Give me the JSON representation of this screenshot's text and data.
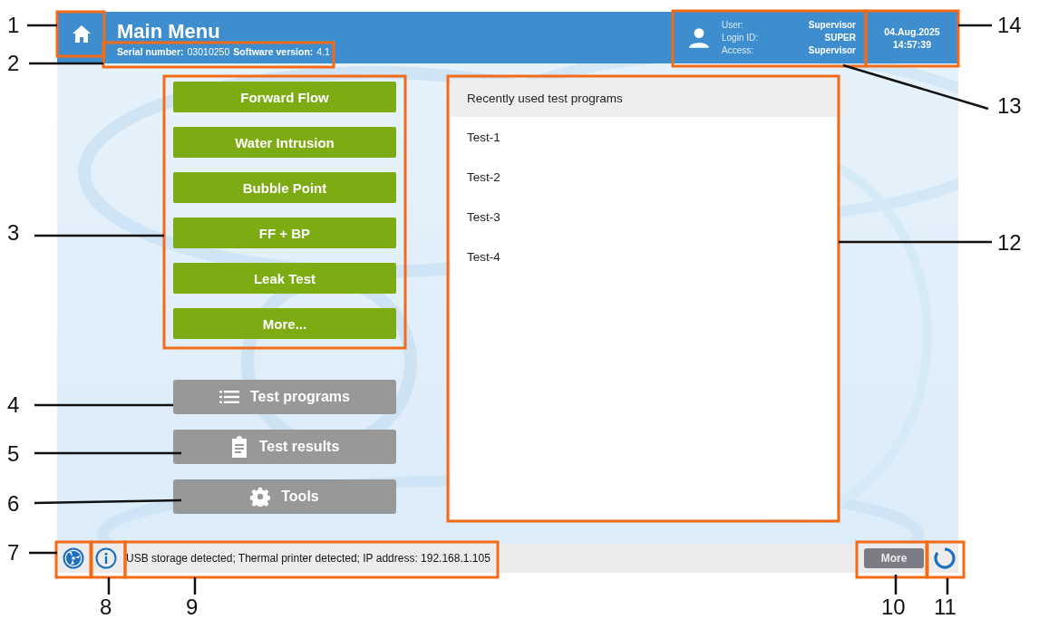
{
  "header": {
    "title": "Main Menu",
    "serial_label": "Serial number:",
    "serial": "03010250",
    "version_label": "Software version:",
    "version": "4.1"
  },
  "user": {
    "rows": [
      {
        "label": "User:",
        "value": "Supervisor"
      },
      {
        "label": "Login ID:",
        "value": "SUPER"
      },
      {
        "label": "Access:",
        "value": "Supervisor"
      }
    ]
  },
  "datetime": {
    "date": "04.Aug.2025",
    "time": "14:57:39"
  },
  "test_buttons": [
    "Forward Flow",
    "Water Intrusion",
    "Bubble Point",
    "FF + BP",
    "Leak Test",
    "More..."
  ],
  "menu_buttons": [
    {
      "label": "Test programs",
      "kind": "list"
    },
    {
      "label": "Test results",
      "kind": "clipboard"
    },
    {
      "label": "Tools",
      "kind": "settings"
    }
  ],
  "recent": {
    "title": "Recently used test programs",
    "items": [
      "Test-1",
      "Test-2",
      "Test-3",
      "Test-4"
    ]
  },
  "status_bar": {
    "message": "USB storage detected; Thermal printer detected; IP address: 192.168.1.105",
    "more": "More"
  },
  "callouts": [
    {
      "label": "1"
    },
    {
      "label": "14"
    },
    {
      "label": "2"
    },
    {
      "label": "13"
    },
    {
      "label": "3"
    },
    {
      "label": "12"
    },
    {
      "label": "4"
    },
    {
      "label": "5"
    },
    {
      "label": "6"
    },
    {
      "label": "7"
    },
    {
      "label": "8"
    },
    {
      "label": "9"
    },
    {
      "label": "10"
    },
    {
      "label": "11"
    }
  ]
}
